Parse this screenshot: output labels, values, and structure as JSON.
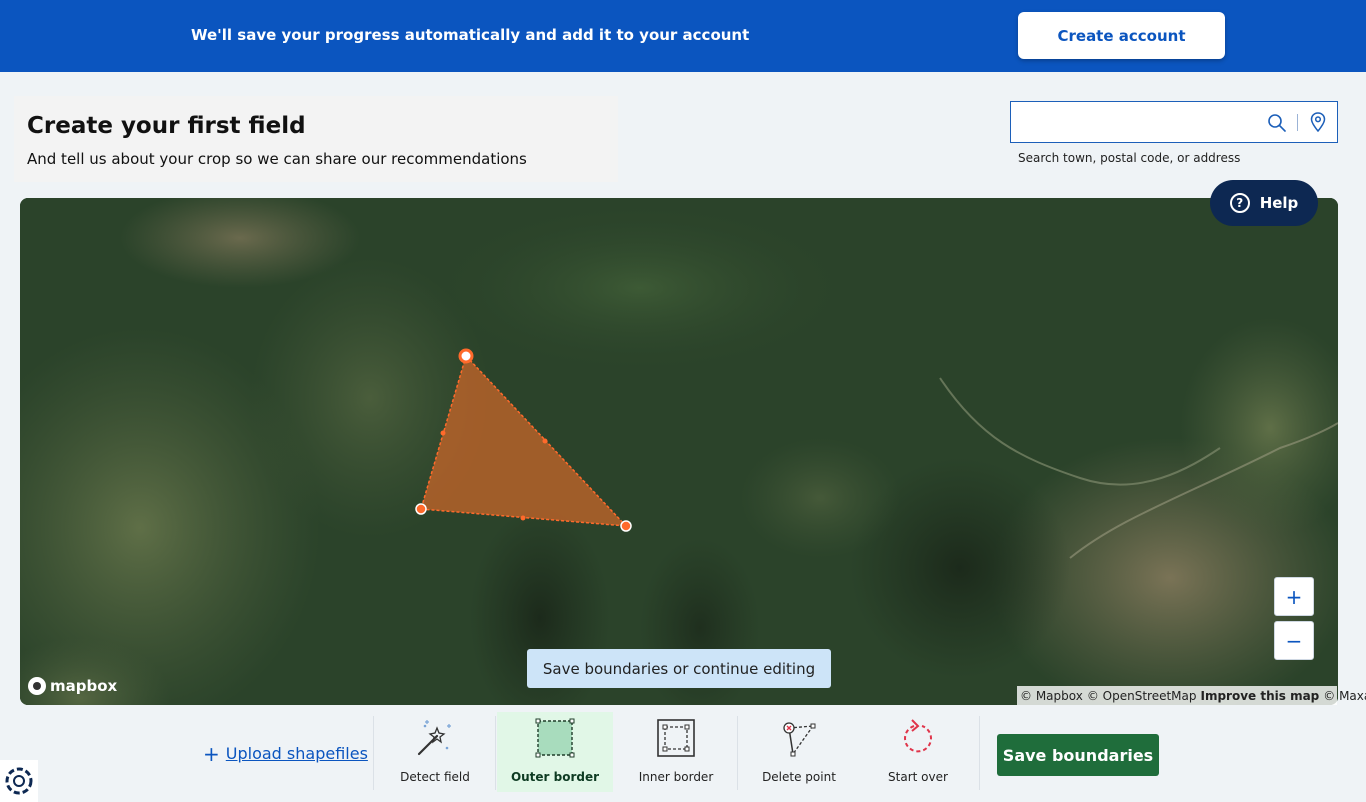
{
  "banner": {
    "message": "We'll save your progress automatically and add it to your account",
    "create_account_label": "Create account"
  },
  "header": {
    "title": "Create your first field",
    "subtitle": "And tell us about your crop so we can share our recommendations"
  },
  "search": {
    "value": "",
    "placeholder": "",
    "hint": "Search town, postal code, or address",
    "search_icon": "search-icon",
    "location_icon": "map-pin-icon"
  },
  "help": {
    "label": "Help",
    "icon": "question-circle-icon"
  },
  "map": {
    "zoom_in_label": "+",
    "zoom_out_label": "−",
    "toast": "Save boundaries or continue editing",
    "logo_text": "mapbox",
    "attribution": {
      "mapbox": "© Mapbox",
      "osm": "© OpenStreetMap",
      "improve": "Improve this map",
      "maxar": "© Maxar"
    },
    "field_fill_color": "#c8652a",
    "field_stroke_color": "#ff6a2b"
  },
  "toolbar": {
    "upload_label": "Upload shapefiles",
    "tools": [
      {
        "label": "Detect field",
        "icon": "magic-wand-icon",
        "active": false
      },
      {
        "label": "Outer border",
        "icon": "outer-border-icon",
        "active": true
      },
      {
        "label": "Inner border",
        "icon": "inner-border-icon",
        "active": false
      },
      {
        "label": "Delete point",
        "icon": "delete-point-icon",
        "active": false
      },
      {
        "label": "Start over",
        "icon": "start-over-icon",
        "active": false
      }
    ],
    "save_label": "Save boundaries"
  },
  "colors": {
    "brand_blue": "#0b55bf",
    "navy": "#0d2852",
    "save_green": "#1f6d3b",
    "active_tool_bg": "#e1f7e7",
    "toast_bg": "#cde4f8"
  }
}
